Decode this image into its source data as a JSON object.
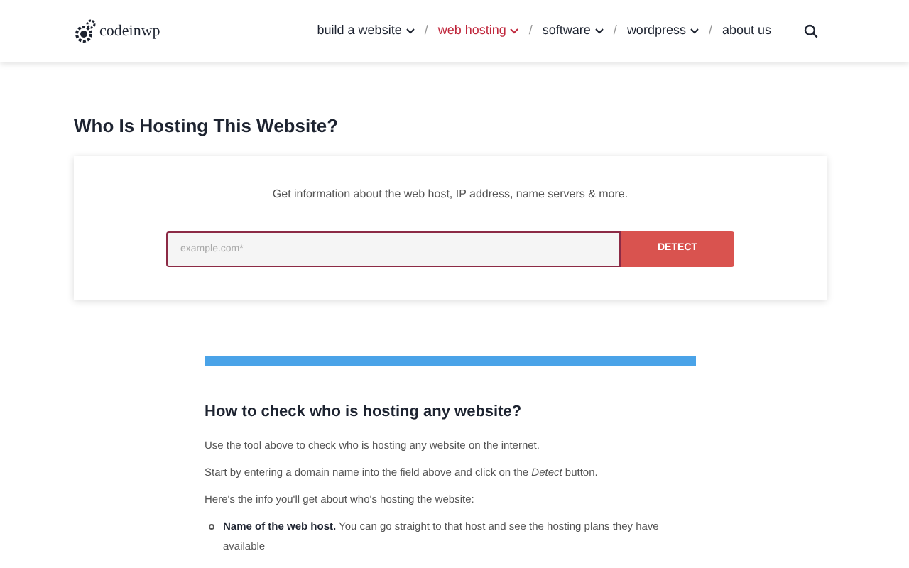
{
  "logo": {
    "text": "codeinwp"
  },
  "nav": [
    {
      "label": "build a website",
      "selected": false,
      "dropdown": true
    },
    {
      "separator": "/",
      "label": "web hosting",
      "selected": true,
      "dropdown": true
    },
    {
      "separator": "/",
      "label": "software",
      "selected": false,
      "dropdown": true
    },
    {
      "separator": "/",
      "label": "wordpress",
      "selected": false,
      "dropdown": true
    },
    {
      "separator": "/",
      "label": "about us",
      "selected": false
    }
  ],
  "title": "Who Is Hosting This Website?",
  "tool": {
    "intro": "Get information about the web host, IP address, name servers & more.",
    "placeholder": "example.com*",
    "button": "DETECT"
  },
  "article": {
    "heading": "How to check who is hosting any website?",
    "paragraphs": [
      "Use the tool above to check who is hosting any website on the internet.",
      "Start by entering a domain name into the field above and click on the *Detect* button.",
      "Here's the info you'll get about who's hosting the website:"
    ],
    "items": [
      "**Name of the web host.** You can go straight to that host and see the hosting plans they have available"
    ]
  }
}
